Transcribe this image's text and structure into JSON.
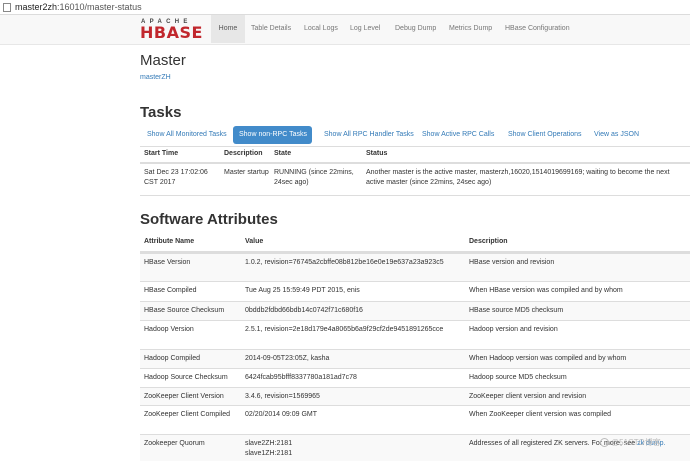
{
  "browser": {
    "host": "master2zh",
    "path": ":16010/master-status"
  },
  "logo": {
    "line1": "APACHE",
    "line2": "HBASE",
    "brand_color": "#c1272d"
  },
  "nav": [
    "Home",
    "Table Details",
    "Local Logs",
    "Log Level",
    "Debug Dump",
    "Metrics Dump",
    "HBase Configuration"
  ],
  "master": {
    "heading": "Master",
    "hostname": "masterZH"
  },
  "tasks": {
    "heading": "Tasks",
    "filters": [
      "Show All Monitored Tasks",
      "Show non-RPC Tasks",
      "Show All RPC Handler Tasks",
      "Show Active RPC Calls",
      "Show Client Operations",
      "View as JSON"
    ],
    "active_filter": "Show non-RPC Tasks",
    "columns": [
      "Start Time",
      "Description",
      "State",
      "Status"
    ],
    "rows": [
      {
        "start_time": "Sat Dec 23 17:02:06 CST 2017",
        "description": "Master startup",
        "state": "RUNNING (since 22mins, 24sec ago)",
        "status": "Another master is the active master, masterzh,16020,1514019699169; waiting to become the next active master (since 22mins, 24sec ago)"
      }
    ]
  },
  "software": {
    "heading": "Software Attributes",
    "columns": [
      "Attribute Name",
      "Value",
      "Description"
    ],
    "rows": [
      {
        "name": "HBase Version",
        "value": "1.0.2, revision=76745a2cbffe08b812be16e0e19e637a23a923c5",
        "desc": "HBase version and revision"
      },
      {
        "name": "HBase Compiled",
        "value": "Tue Aug 25 15:59:49 PDT 2015, enis",
        "desc": "When HBase version was compiled and by whom"
      },
      {
        "name": "HBase Source Checksum",
        "value": "0bddb2fdbd66bdb14c0742f71c680f16",
        "desc": "HBase source MD5 checksum"
      },
      {
        "name": "Hadoop Version",
        "value": "2.5.1, revision=2e18d179e4a8065b6a9f29cf2de9451891265cce",
        "desc": "Hadoop version and revision"
      },
      {
        "name": "Hadoop Compiled",
        "value": "2014-09-05T23:05Z, kasha",
        "desc": "When Hadoop version was compiled and by whom"
      },
      {
        "name": "Hadoop Source Checksum",
        "value": "6424fcab95bfff8337780a181ad7c78",
        "desc": "Hadoop source MD5 checksum"
      },
      {
        "name": "ZooKeeper Client Version",
        "value": "3.4.6, revision=1569965",
        "desc": "ZooKeeper client version and revision"
      },
      {
        "name": "ZooKeeper Client Compiled",
        "value": "02/20/2014 09:09 GMT",
        "desc": "When ZooKeeper client version was compiled"
      },
      {
        "name": "Zookeeper Quorum",
        "value": "slave2ZH:2181\nslave1ZH:2181",
        "desc": "Addresses of all registered ZK servers. For more, see ",
        "desc_link": "zk dump."
      }
    ]
  },
  "watermark": "@51CTO博客"
}
